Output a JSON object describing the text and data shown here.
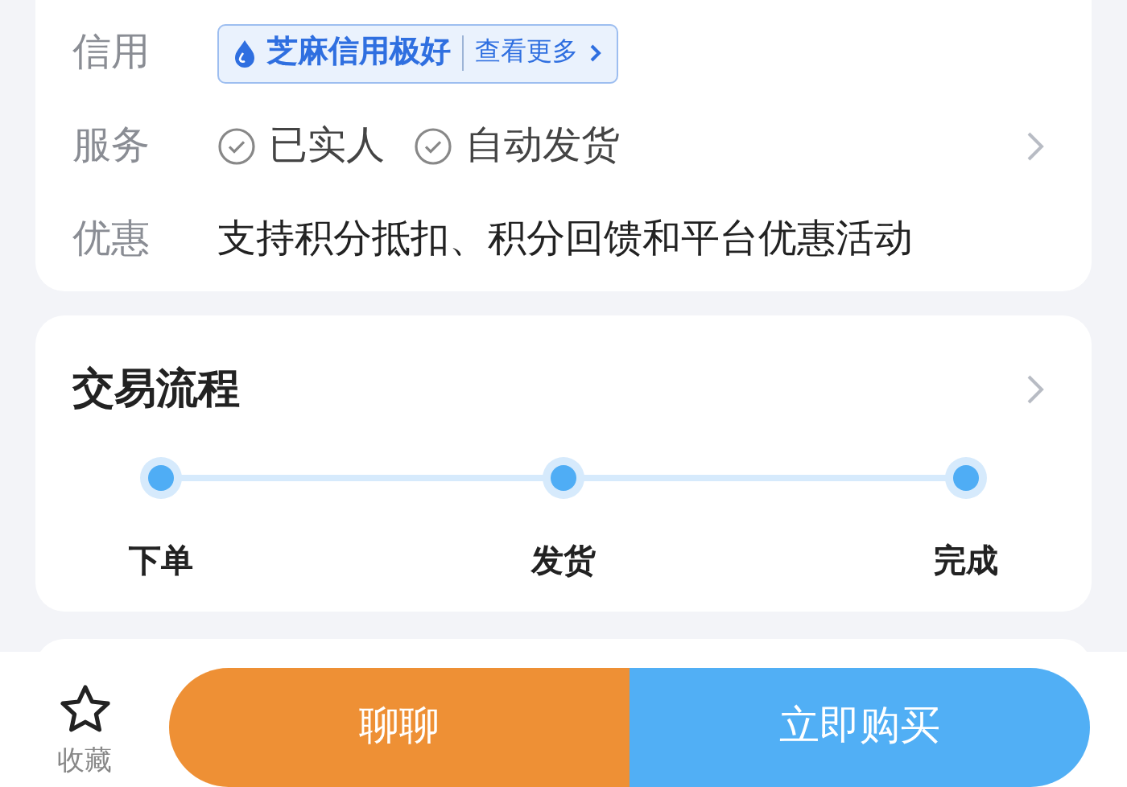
{
  "info_card": {
    "rows": [
      {
        "kind": "credit",
        "label": "信用",
        "credit_badge": {
          "title": "芝麻信用极好",
          "link": "查看更多"
        }
      },
      {
        "kind": "services",
        "label": "服务",
        "services": [
          "已实人",
          "自动发货"
        ]
      },
      {
        "kind": "text",
        "label": "优惠",
        "text": "支持积分抵扣、积分回馈和平台优惠活动"
      }
    ]
  },
  "process_card": {
    "title": "交易流程",
    "steps": [
      "下单",
      "发货",
      "完成"
    ]
  },
  "bottom_bar": {
    "favorite": "收藏",
    "chat_button": "聊聊",
    "buy_button": "立即购买"
  }
}
